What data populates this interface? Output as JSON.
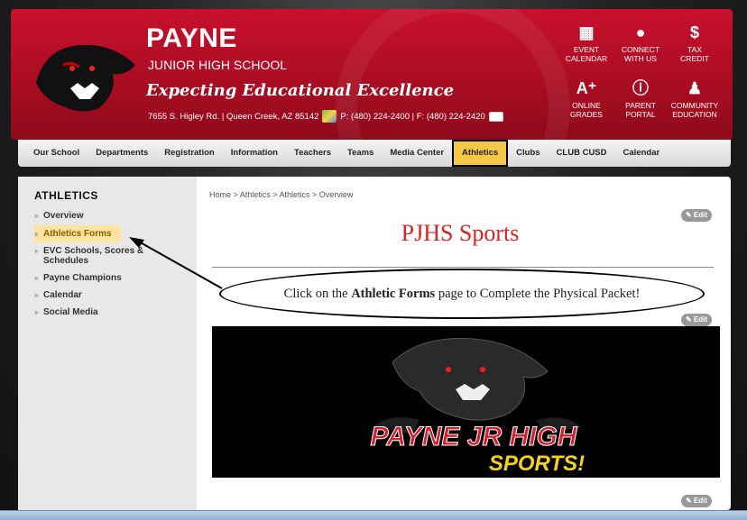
{
  "header": {
    "school_name": "PAYNE",
    "school_sub": "JUNIOR HIGH SCHOOL",
    "motto": "Expecting Educational Excellence",
    "address": "7655 S. Higley Rd. | Queen Creek, AZ 85142",
    "phone": "P: (480) 224-2400 | F: (480) 224-2420",
    "quick_links": [
      {
        "line1": "EVENT",
        "line2": "CALENDAR",
        "icon": "calendar-icon"
      },
      {
        "line1": "CONNECT",
        "line2": "WITH US",
        "icon": "chat-icon"
      },
      {
        "line1": "TAX",
        "line2": "CREDIT",
        "icon": "dollar-icon"
      },
      {
        "line1": "ONLINE",
        "line2": "GRADES",
        "icon": "grade-icon"
      },
      {
        "line1": "PARENT",
        "line2": "PORTAL",
        "icon": "info-icon"
      },
      {
        "line1": "COMMUNITY",
        "line2": "EDUCATION",
        "icon": "community-icon"
      }
    ]
  },
  "nav": [
    "Our School",
    "Departments",
    "Registration",
    "Information",
    "Teachers",
    "Teams",
    "Media Center",
    "Athletics",
    "Clubs",
    "CLUB CUSD",
    "Calendar"
  ],
  "sidebar": {
    "heading": "ATHLETICS",
    "items": [
      "Overview",
      "Athletics Forms",
      "EVC Schools, Scores & Schedules",
      "Payne Champions",
      "Calendar",
      "Social Media"
    ]
  },
  "breadcrumb": "Home  >  Athletics  >  Athletics  >  Overview",
  "edit_label": "Edit",
  "page_title": "PJHS Sports",
  "callout": {
    "pre": "Click on the ",
    "bold": "Athletic Forms",
    "post": " page to Complete the Physical Packet!"
  },
  "banner": {
    "line1": "PAYNE JR HIGH",
    "line2": "SPORTS!"
  },
  "colors": {
    "brand_red": "#c8102e",
    "highlight": "#f6c744",
    "title_red": "#dd2222"
  }
}
